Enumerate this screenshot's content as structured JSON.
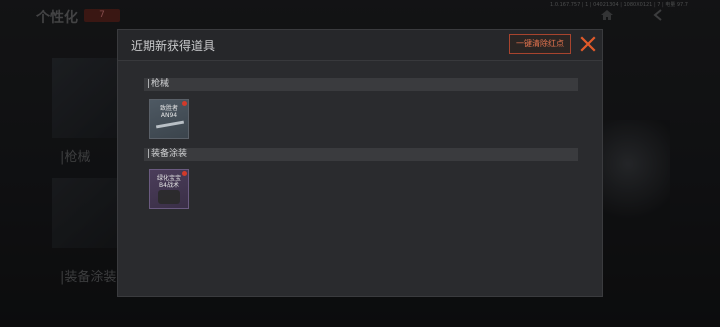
{
  "background": {
    "title": "个性化",
    "tag": "7",
    "section1": "|枪械",
    "section2": "|装备涂装",
    "version": "1.0.167.757 | 1 | 04021304 | 1080X0121 | 7 | 电量 97.7"
  },
  "modal": {
    "title": "近期新获得道具",
    "clear_button": "一键清除红点",
    "sections": [
      {
        "label": "枪械",
        "items": [
          {
            "name_line1": "致胜者",
            "name_line2": "AN94"
          }
        ]
      },
      {
        "label": "装备涂装",
        "items": [
          {
            "name_line1": "绿化宝宝",
            "name_line2": "B4战术"
          }
        ]
      }
    ]
  },
  "colors": {
    "accent": "#e5744f",
    "close": "#e15a2a",
    "dot": "#d23a2a"
  }
}
